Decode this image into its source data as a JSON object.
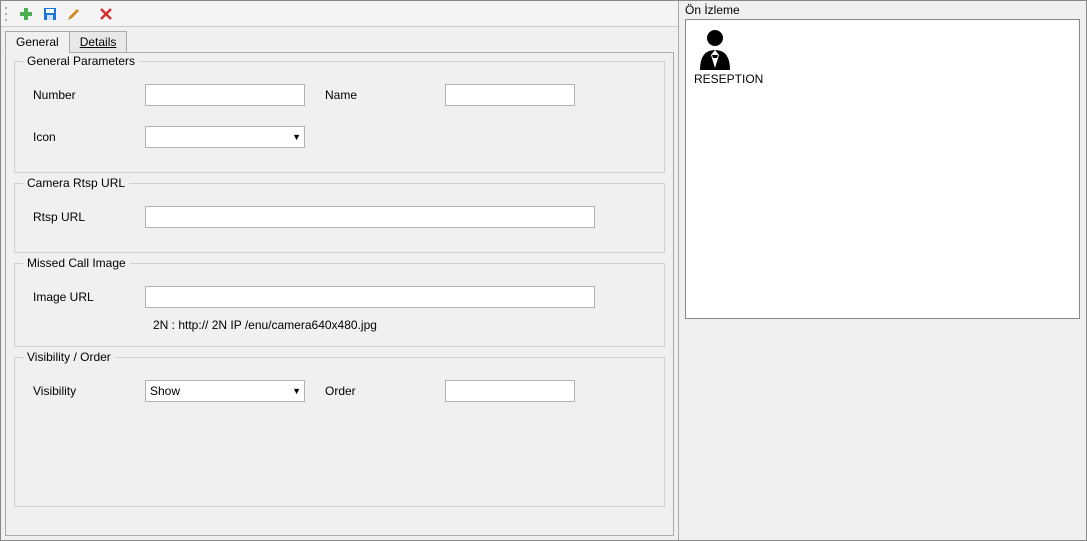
{
  "tabs": {
    "general": "General",
    "details": "Details"
  },
  "groups": {
    "generalParams": {
      "title": "General Parameters",
      "numberLabel": "Number",
      "numberValue": "",
      "nameLabel": "Name",
      "nameValue": "",
      "iconLabel": "Icon",
      "iconValue": ""
    },
    "cameraRtsp": {
      "title": "Camera Rtsp URL",
      "rtspLabel": "Rtsp URL",
      "rtspValue": ""
    },
    "missedCall": {
      "title": "Missed Call Image",
      "imageUrlLabel": "Image URL",
      "imageUrlValue": "",
      "hint": "2N :  http:// 2N IP /enu/camera640x480.jpg"
    },
    "visibility": {
      "title": "Visibility / Order",
      "visibilityLabel": "Visibility",
      "visibilityValue": "Show",
      "orderLabel": "Order",
      "orderValue": ""
    }
  },
  "preview": {
    "title": "Ön İzleme",
    "itemLabel": "RESEPTION"
  },
  "colors": {
    "addIcon": "#4caf50",
    "saveIcon": "#1e73d6",
    "editIcon": "#d68a1e",
    "deleteIcon": "#d32f2f"
  }
}
